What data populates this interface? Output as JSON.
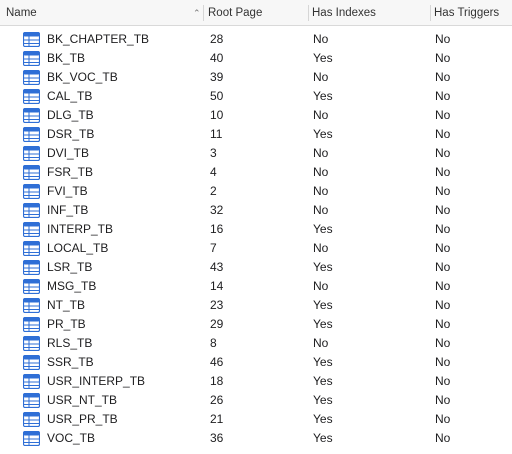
{
  "columns": {
    "name": "Name",
    "root_page": "Root Page",
    "has_indexes": "Has Indexes",
    "has_triggers": "Has Triggers"
  },
  "rows": [
    {
      "name": "BK_CHAPTER_TB",
      "root_page": "28",
      "has_indexes": "No",
      "has_triggers": "No"
    },
    {
      "name": "BK_TB",
      "root_page": "40",
      "has_indexes": "Yes",
      "has_triggers": "No"
    },
    {
      "name": "BK_VOC_TB",
      "root_page": "39",
      "has_indexes": "No",
      "has_triggers": "No"
    },
    {
      "name": "CAL_TB",
      "root_page": "50",
      "has_indexes": "Yes",
      "has_triggers": "No"
    },
    {
      "name": "DLG_TB",
      "root_page": "10",
      "has_indexes": "No",
      "has_triggers": "No"
    },
    {
      "name": "DSR_TB",
      "root_page": "11",
      "has_indexes": "Yes",
      "has_triggers": "No"
    },
    {
      "name": "DVI_TB",
      "root_page": "3",
      "has_indexes": "No",
      "has_triggers": "No"
    },
    {
      "name": "FSR_TB",
      "root_page": "4",
      "has_indexes": "No",
      "has_triggers": "No"
    },
    {
      "name": "FVI_TB",
      "root_page": "2",
      "has_indexes": "No",
      "has_triggers": "No"
    },
    {
      "name": "INF_TB",
      "root_page": "32",
      "has_indexes": "No",
      "has_triggers": "No"
    },
    {
      "name": "INTERP_TB",
      "root_page": "16",
      "has_indexes": "Yes",
      "has_triggers": "No"
    },
    {
      "name": "LOCAL_TB",
      "root_page": "7",
      "has_indexes": "No",
      "has_triggers": "No"
    },
    {
      "name": "LSR_TB",
      "root_page": "43",
      "has_indexes": "Yes",
      "has_triggers": "No"
    },
    {
      "name": "MSG_TB",
      "root_page": "14",
      "has_indexes": "No",
      "has_triggers": "No"
    },
    {
      "name": "NT_TB",
      "root_page": "23",
      "has_indexes": "Yes",
      "has_triggers": "No"
    },
    {
      "name": "PR_TB",
      "root_page": "29",
      "has_indexes": "Yes",
      "has_triggers": "No"
    },
    {
      "name": "RLS_TB",
      "root_page": "8",
      "has_indexes": "No",
      "has_triggers": "No"
    },
    {
      "name": "SSR_TB",
      "root_page": "46",
      "has_indexes": "Yes",
      "has_triggers": "No"
    },
    {
      "name": "USR_INTERP_TB",
      "root_page": "18",
      "has_indexes": "Yes",
      "has_triggers": "No"
    },
    {
      "name": "USR_NT_TB",
      "root_page": "26",
      "has_indexes": "Yes",
      "has_triggers": "No"
    },
    {
      "name": "USR_PR_TB",
      "root_page": "21",
      "has_indexes": "Yes",
      "has_triggers": "No"
    },
    {
      "name": "VOC_TB",
      "root_page": "36",
      "has_indexes": "Yes",
      "has_triggers": "No"
    }
  ],
  "icons": {
    "row_icon": "table-icon",
    "sort_icon": "chevron-up-icon"
  },
  "colors": {
    "icon_blue": "#2f6fd6",
    "header_bg": "#f7f7f7"
  }
}
